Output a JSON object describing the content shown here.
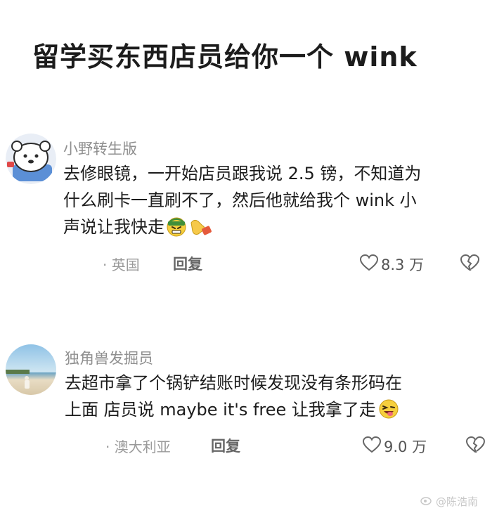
{
  "title": "留学买东西店员给你一个 wink",
  "comments": [
    {
      "username": "小野转生版",
      "lines": [
        "去修眼镜，一开始店员跟我说 2.5 镑，不知道为",
        "什么刷卡一直刷不了，然后他就给我个 wink 小",
        "声说让我快走"
      ],
      "emojis": [
        "grimace-face-emoji",
        "pointing-hand-emoji"
      ],
      "location": "· 英国",
      "reply_label": "回复",
      "likes": "8.3 万"
    },
    {
      "username": "独角兽发掘员",
      "lines": [
        "去超市拿了个锅铲结账时候发现没有条形码在",
        "上面 店员说 maybe it's free 让我拿了走"
      ],
      "emojis": [
        "winking-tongue-face-emoji"
      ],
      "location": "· 澳大利亚",
      "reply_label": "回复",
      "likes": "9.0 万"
    }
  ],
  "watermark": "@陈浩南",
  "colors": {
    "meta": "#9a9a9a",
    "text": "#1c1c1c",
    "username": "#8f8f8f"
  }
}
